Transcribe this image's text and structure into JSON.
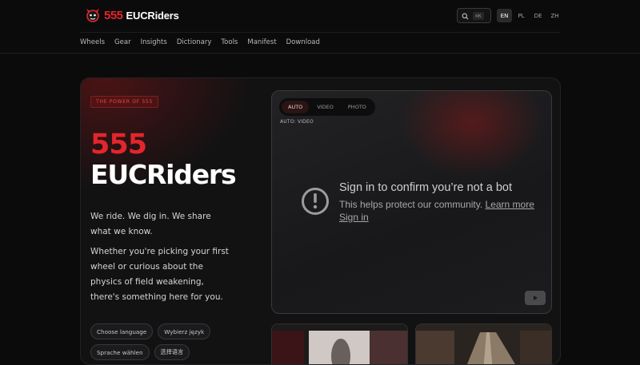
{
  "header": {
    "logo_num": "555",
    "logo_name": "EUCRiders",
    "search_shortcut": "⌘K",
    "languages": [
      {
        "code": "EN",
        "active": true
      },
      {
        "code": "PL",
        "active": false
      },
      {
        "code": "DE",
        "active": false
      },
      {
        "code": "ZH",
        "active": false
      }
    ]
  },
  "nav": [
    "Wheels",
    "Gear",
    "Insights",
    "Dictionary",
    "Tools",
    "Manifest",
    "Download"
  ],
  "hero": {
    "badge": "THE POWER OF 555",
    "title_line1": "555",
    "title_line2": "EUCRiders",
    "para1": "We ride. We dig in. We share what we know.",
    "para2": "Whether you're picking your first wheel or curious about the physics of field weakening, there's something here for you.",
    "chips": [
      "Choose language",
      "Wybierz język",
      "Sprache wählen",
      "选择语言"
    ]
  },
  "video": {
    "tabs": [
      "AUTO",
      "VIDEO",
      "PHOTO"
    ],
    "active_tab": "AUTO",
    "mode_label": "AUTO: VIDEO",
    "bot_title": "Sign in to confirm you’re not a bot",
    "bot_sub": "This helps protect our community.",
    "learn_more": "Learn more",
    "sign_in": "Sign in"
  },
  "colors": {
    "accent": "#e3262b",
    "background": "#0b0b0c",
    "card": "#121213"
  }
}
